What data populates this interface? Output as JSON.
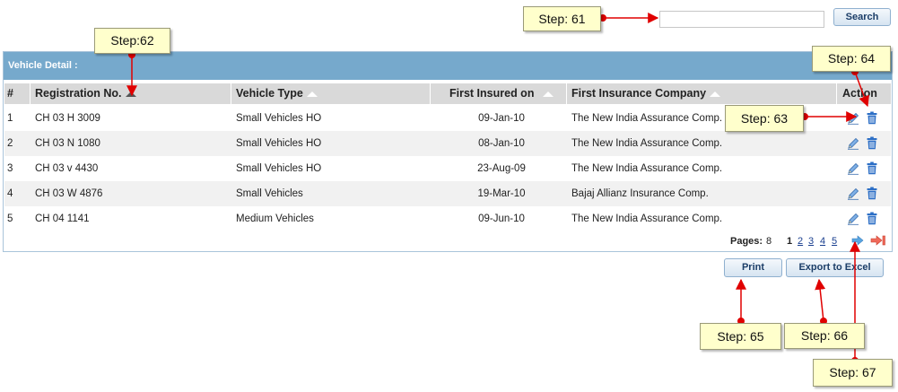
{
  "search": {
    "placeholder": "",
    "value": "",
    "button_label": "Search"
  },
  "panel": {
    "title": "Vehicle Detail :"
  },
  "table": {
    "headers": {
      "num": "#",
      "registration": "Registration No.",
      "vehicle_type": "Vehicle Type",
      "first_insured": "First Insured on",
      "company": "First Insurance Company",
      "action": "Action"
    },
    "rows": [
      {
        "num": "1",
        "registration": "CH 03 H 3009",
        "vehicle_type": "Small Vehicles HO",
        "first_insured": "09-Jan-10",
        "company": "The New India Assurance Comp."
      },
      {
        "num": "2",
        "registration": "CH 03 N 1080",
        "vehicle_type": "Small Vehicles HO",
        "first_insured": "08-Jan-10",
        "company": "The New India Assurance Comp."
      },
      {
        "num": "3",
        "registration": "CH 03 v 4430",
        "vehicle_type": "Small Vehicles HO",
        "first_insured": "23-Aug-09",
        "company": "The New India Assurance Comp."
      },
      {
        "num": "4",
        "registration": "CH 03 W 4876",
        "vehicle_type": "Small Vehicles",
        "first_insured": "19-Mar-10",
        "company": "Bajaj Allianz Insurance Comp."
      },
      {
        "num": "5",
        "registration": "CH 04 1141",
        "vehicle_type": "Medium Vehicles",
        "first_insured": "09-Jun-10",
        "company": "The New India Assurance Comp."
      }
    ]
  },
  "pager": {
    "label": "Pages:",
    "count": "8",
    "pages": [
      "1",
      "2",
      "3",
      "4",
      "5"
    ],
    "current": "1"
  },
  "buttons": {
    "print": "Print",
    "export": "Export to Excel"
  },
  "annotations": {
    "step61": "Step: 61",
    "step62": "Step:62",
    "step63": "Step: 63",
    "step64": "Step: 64",
    "step65": "Step: 65",
    "step66": "Step: 66",
    "step67": "Step: 67"
  },
  "colors": {
    "header_bar": "#76a9cc",
    "callout_bg": "#ffffcc",
    "marker": "#e00000",
    "edit_icon": "#4a7fc1",
    "trash_icon": "#2d6fc6"
  }
}
